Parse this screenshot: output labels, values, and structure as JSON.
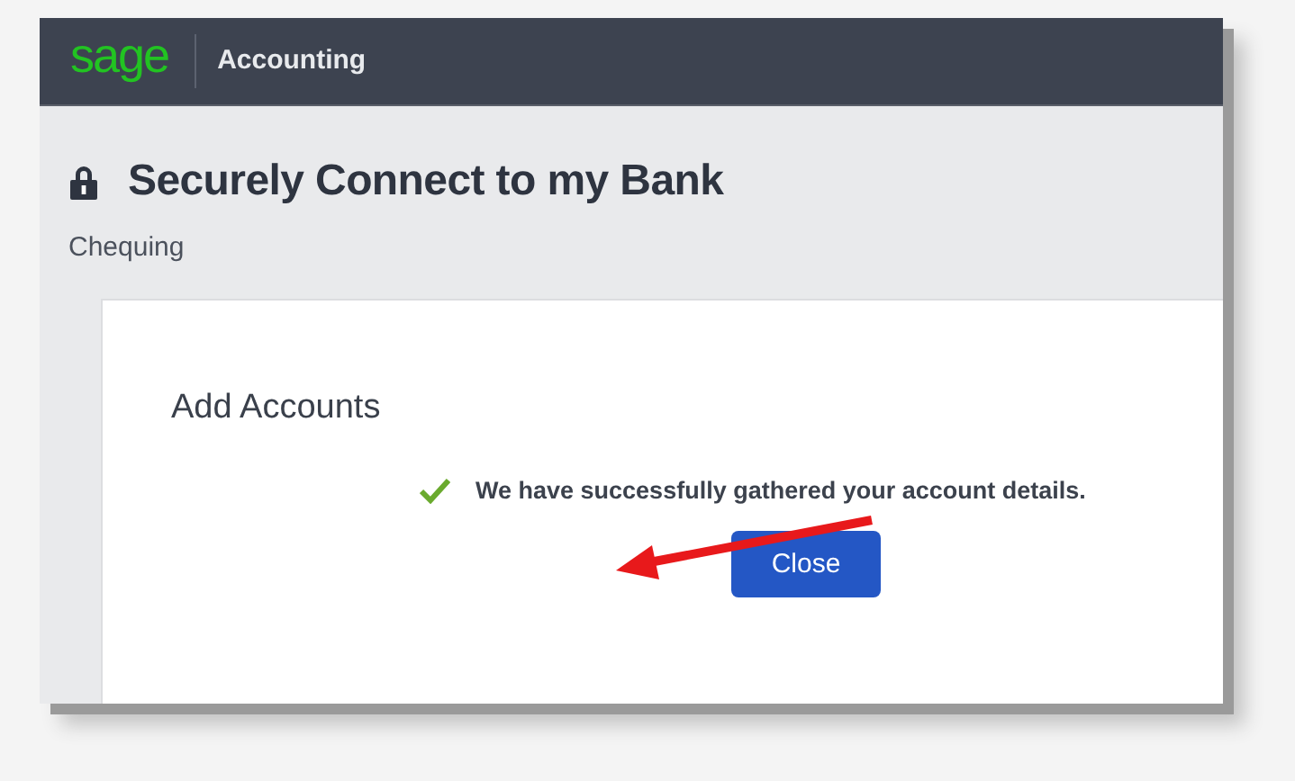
{
  "header": {
    "logo": "sage",
    "app_name": "Accounting"
  },
  "page": {
    "title": "Securely Connect to my Bank",
    "subtitle": "Chequing"
  },
  "card": {
    "title": "Add Accounts",
    "message": "We have successfully gathered your account details.",
    "button": "Close"
  }
}
